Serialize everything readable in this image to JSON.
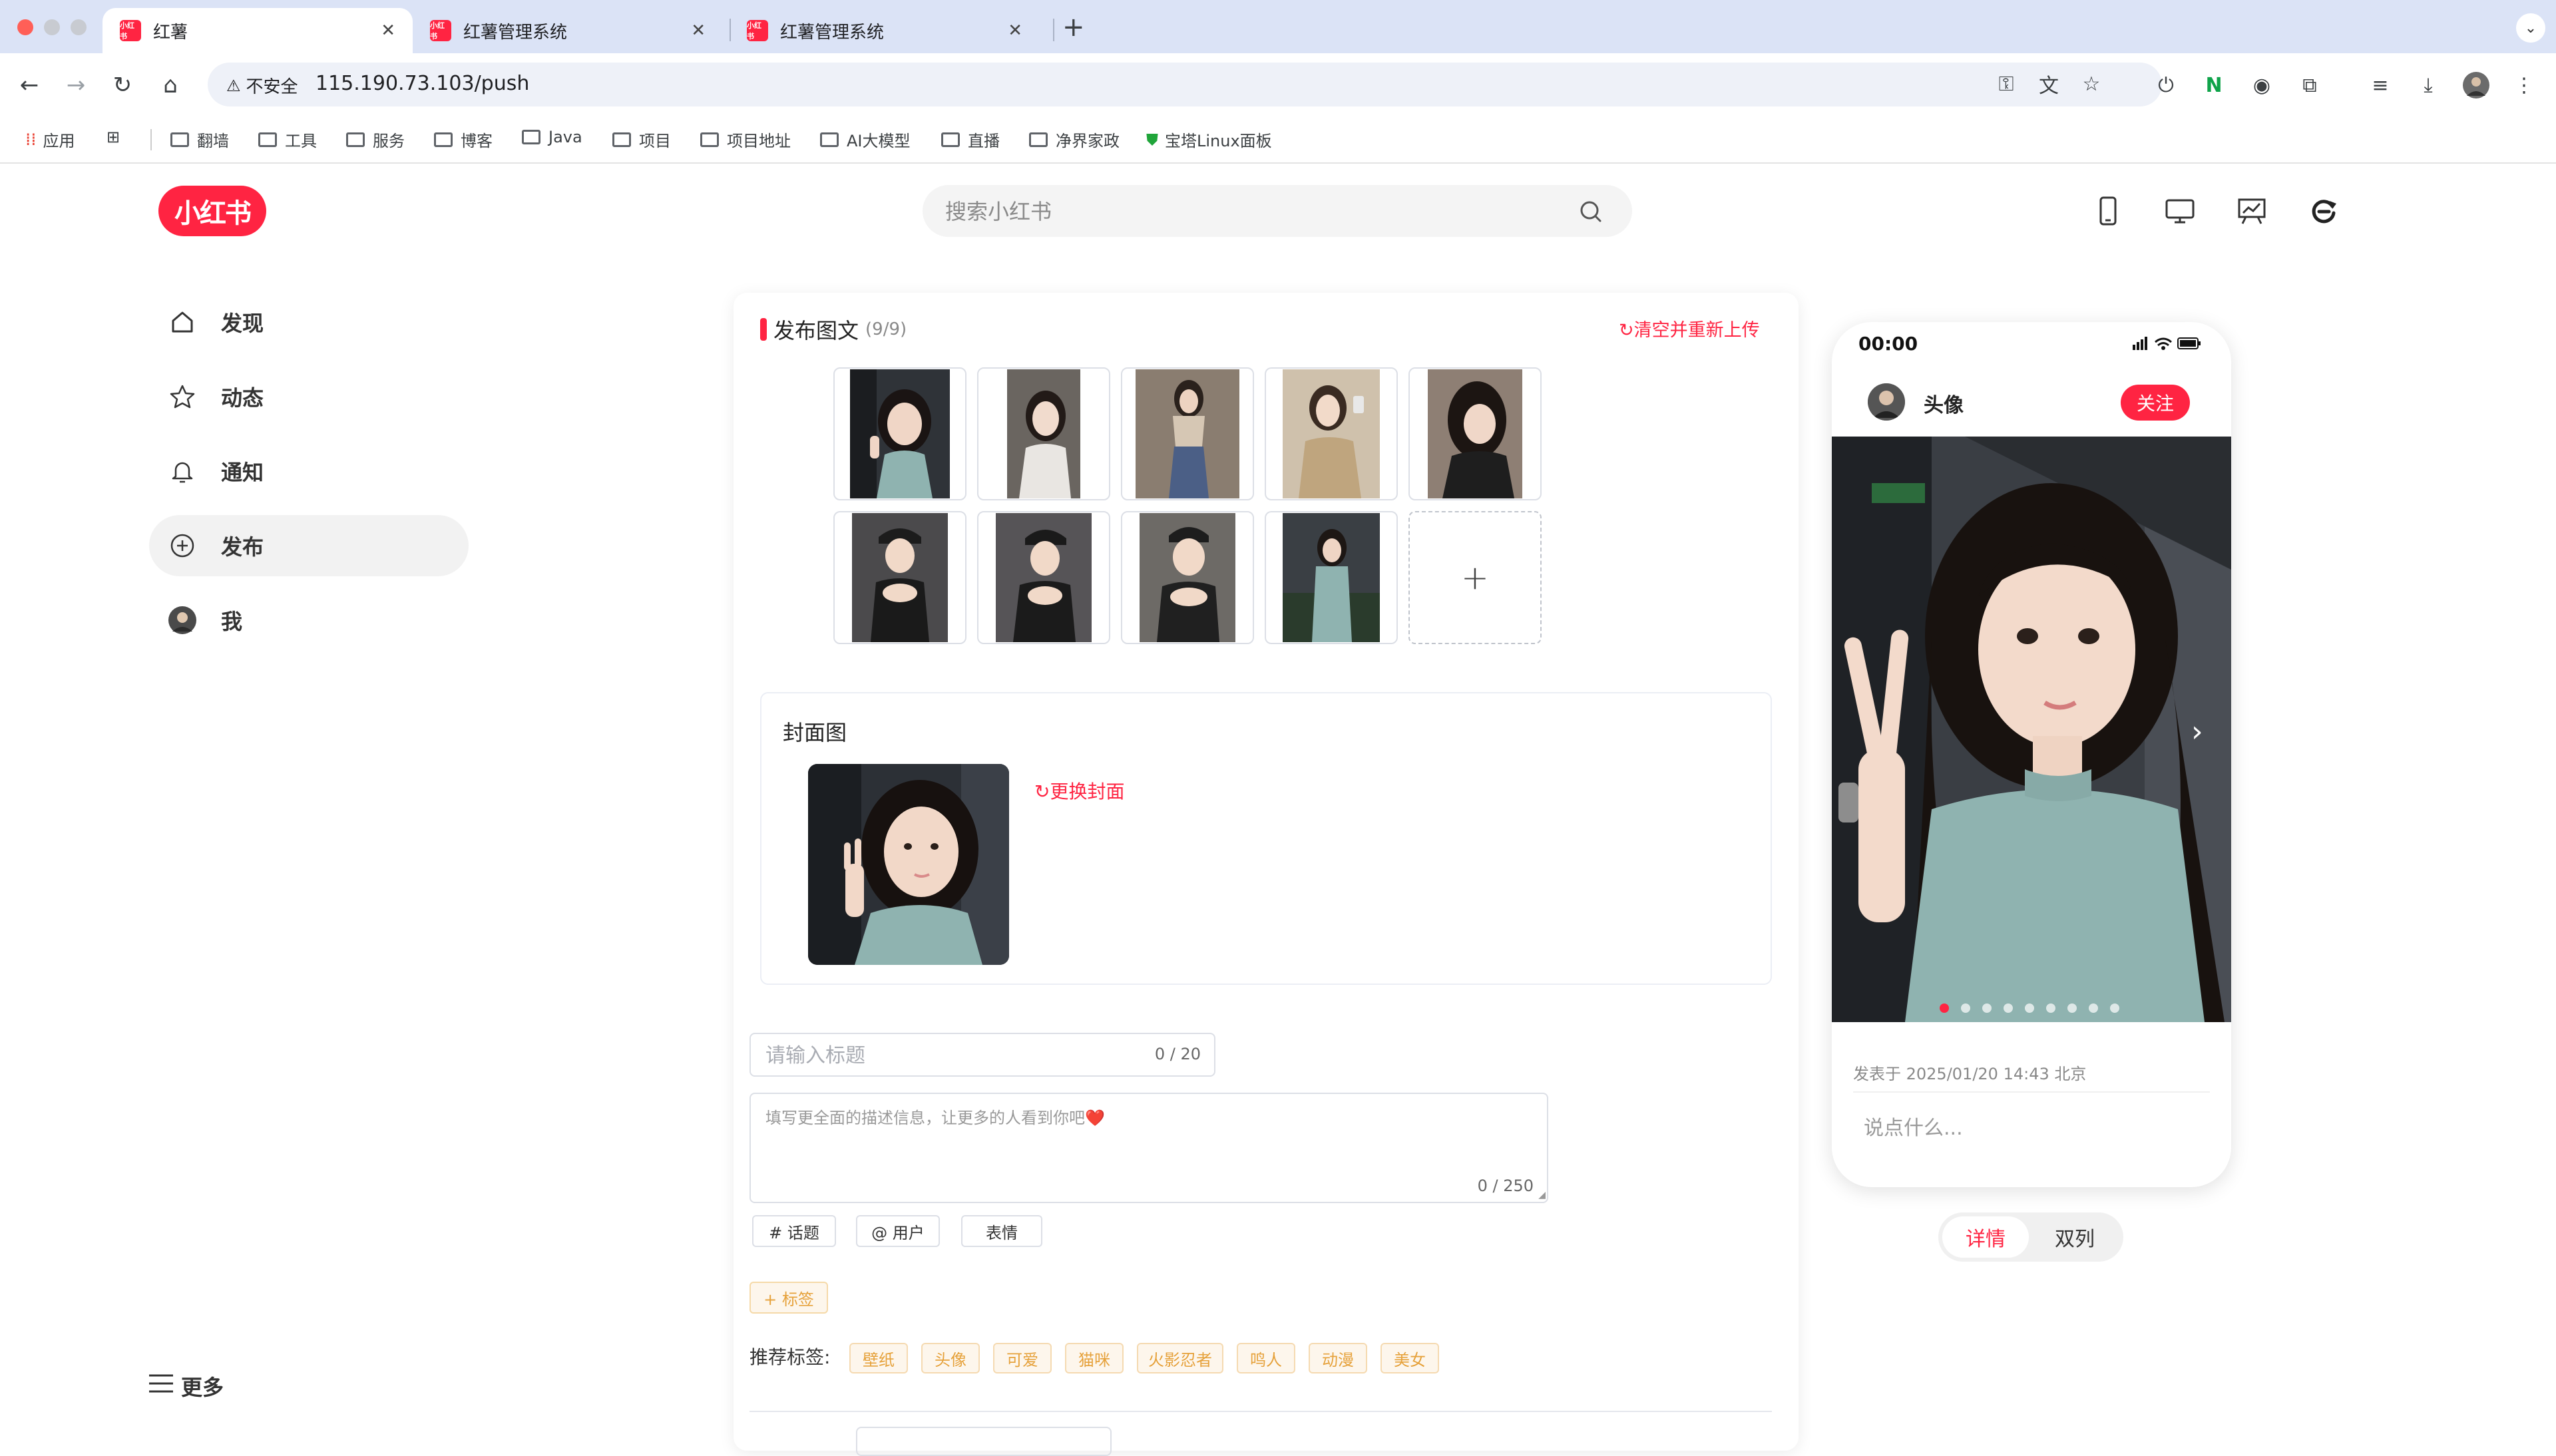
{
  "browser": {
    "tabs": [
      {
        "title": "红薯",
        "favicon": "小红书",
        "active": true
      },
      {
        "title": "红薯管理系统",
        "favicon": "小红书",
        "active": false
      },
      {
        "title": "红薯管理系统",
        "favicon": "小红书",
        "active": false
      }
    ],
    "new_tab": "+",
    "security_label": "不安全",
    "url": "115.190.73.103/push",
    "bookmarks": [
      "应用",
      "翻墙",
      "工具",
      "服务",
      "博客",
      "Java",
      "项目",
      "项目地址",
      "AI大模型",
      "直播",
      "净界家政",
      "宝塔Linux面板"
    ]
  },
  "app": {
    "logo": "小红书",
    "search_placeholder": "搜索小红书",
    "nav": [
      {
        "label": "发现",
        "icon": "home-icon"
      },
      {
        "label": "动态",
        "icon": "star-icon"
      },
      {
        "label": "通知",
        "icon": "bell-icon"
      },
      {
        "label": "发布",
        "icon": "plus-circle-icon",
        "active": true
      },
      {
        "label": "我",
        "icon": "avatar-icon"
      }
    ],
    "more_label": "更多"
  },
  "publish": {
    "title": "发布图文",
    "count": "(9/9)",
    "clear_label": "清空并重新上传",
    "add_tile": "+",
    "cover_title": "封面图",
    "change_cover": "更换封面",
    "title_placeholder": "请输入标题",
    "title_count": "0 / 20",
    "desc_placeholder": "填写更全面的描述信息，让更多的人看到你吧❤️",
    "desc_count": "0 / 250",
    "buttons": [
      "# 话题",
      "@ 用户",
      "表情"
    ],
    "add_tag": "+ 标签",
    "recommend_label": "推荐标签:",
    "recommend_tags": [
      "壁纸",
      "头像",
      "可爱",
      "猫咪",
      "火影忍者",
      "鸣人",
      "动漫",
      "美女"
    ]
  },
  "preview": {
    "time": "00:00",
    "username": "头像",
    "follow": "关注",
    "date": "发表于 2025/01/20 14:43 北京",
    "comment_placeholder": "说点什么...",
    "image_count": 9,
    "active_image": 1,
    "view_detail": "详情",
    "view_double": "双列"
  },
  "colors": {
    "brand": "#ff2442",
    "tag_text": "#e6a23c",
    "tag_bg": "#fdf6ec"
  }
}
